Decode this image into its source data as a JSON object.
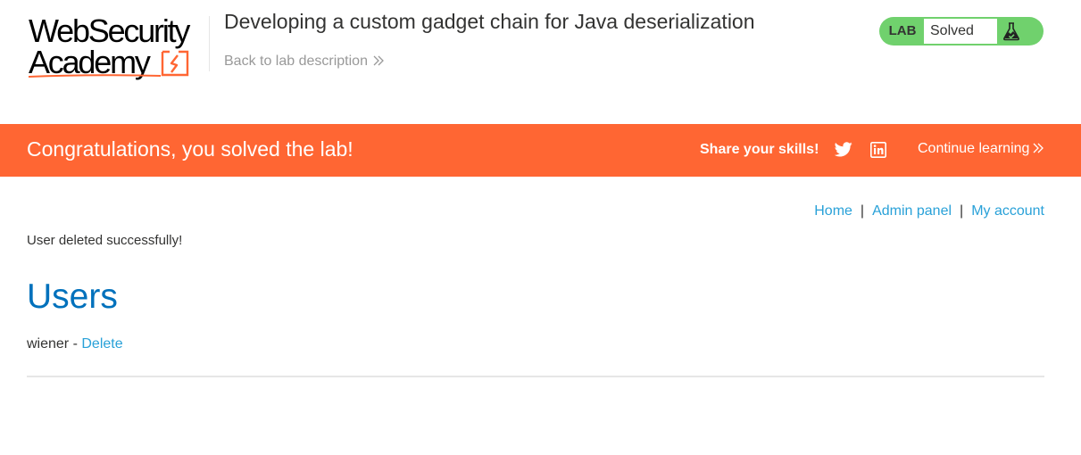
{
  "header": {
    "logo": {
      "line1": "WebSecurity",
      "line2": "Academy"
    },
    "lab_title": "Developing a custom gadget chain for Java deserialization",
    "back_link": "Back to lab description",
    "status": {
      "badge": "LAB",
      "value": "Solved",
      "icon": "flask-icon"
    }
  },
  "banner": {
    "message": "Congratulations, you solved the lab!",
    "share_label": "Share your skills!",
    "social_icons": [
      "twitter-icon",
      "linkedin-icon"
    ],
    "continue_label": "Continue learning",
    "background": "#ff6633"
  },
  "nav": {
    "home": "Home",
    "separator": "|",
    "admin_panel": "Admin panel",
    "my_account": "My account"
  },
  "main": {
    "status_message": "User deleted successfully!",
    "heading": "Users",
    "users": [
      {
        "name": "wiener",
        "separator": " - ",
        "action": "Delete"
      }
    ]
  },
  "colors": {
    "accent_orange": "#ff6633",
    "link_blue": "#29a1d8",
    "heading_blue": "#0071bc",
    "solved_green": "#70d16d"
  }
}
